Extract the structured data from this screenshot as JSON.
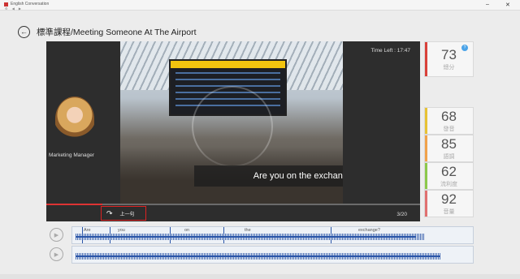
{
  "window": {
    "title": "English Conversation",
    "toolbar_icons": "⚙ ◀ ▶",
    "controls": {
      "minimize": "–",
      "close": "✕"
    }
  },
  "header": {
    "back_icon": "←",
    "title": "標準課程/Meeting Someone At The Airport"
  },
  "stage": {
    "time_left_label": "Time Left : 17:47",
    "caption": "Are you on the exchange?",
    "speaker_role": "Marketing Manager",
    "replay_icon": "↷",
    "prev_label": "上一句",
    "counter": "3/20",
    "progress_fraction": 0.15
  },
  "scores": [
    {
      "value": "73",
      "label": "總分",
      "color": "#d9413a",
      "badge": "?"
    },
    {
      "value": "68",
      "label": "發音",
      "color": "#e7c235"
    },
    {
      "value": "85",
      "label": "語調",
      "color": "#f0a24a"
    },
    {
      "value": "62",
      "label": "流利度",
      "color": "#8cc84b"
    },
    {
      "value": "92",
      "label": "音量",
      "color": "#e07070"
    }
  ],
  "waveform": {
    "words": [
      "Are",
      "you",
      "on",
      "the",
      "exchange?"
    ],
    "play_icon": "▶"
  },
  "status_bar": {
    "left": "",
    "right": ""
  }
}
